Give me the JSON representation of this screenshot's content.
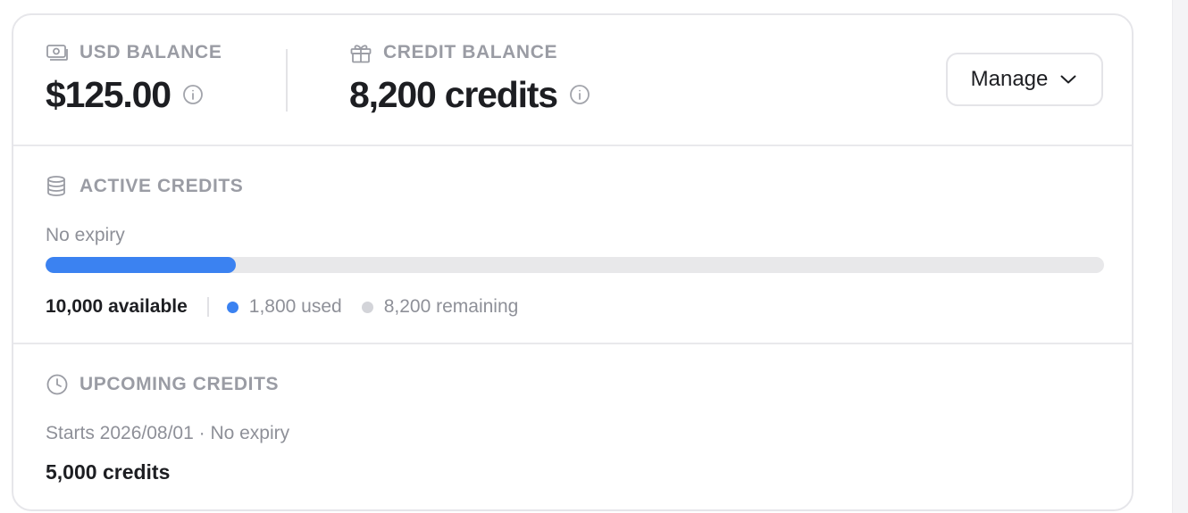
{
  "colors": {
    "accent": "#3b82f1",
    "used_dot": "#3b82f1",
    "remaining_dot": "#d3d4d9",
    "muted_text": "#9a9ca4",
    "primary_text": "#1d1e22"
  },
  "balances": {
    "usd": {
      "icon": "banknote-icon",
      "label": "USD BALANCE",
      "value": "$125.00",
      "info_icon": "info-icon"
    },
    "credit": {
      "icon": "gift-icon",
      "label": "CREDIT BALANCE",
      "value": "8,200 credits",
      "info_icon": "info-icon"
    },
    "manage_button": {
      "label": "Manage",
      "icon": "chevron-down-icon"
    }
  },
  "active_credits": {
    "icon": "database-stack-icon",
    "title": "ACTIVE CREDITS",
    "expiry": "No expiry",
    "progress_used_fraction": 0.18,
    "available": "10,000 available",
    "used": "1,800 used",
    "remaining": "8,200 remaining"
  },
  "upcoming_credits": {
    "icon": "clock-icon",
    "title": "UPCOMING CREDITS",
    "schedule": "Starts 2026/08/01 · No expiry",
    "amount": "5,000 credits"
  }
}
